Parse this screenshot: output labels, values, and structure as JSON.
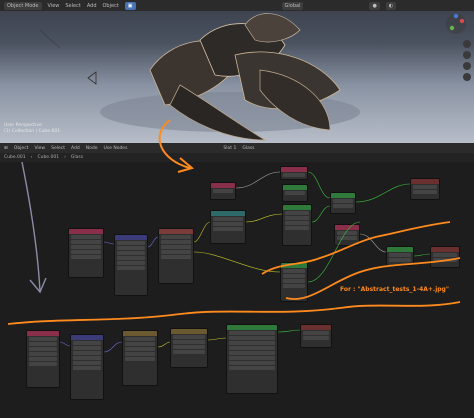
{
  "viewport": {
    "header": {
      "mode": "Object Mode",
      "view": "View",
      "select": "Select",
      "add": "Add",
      "object": "Object",
      "global": "Global"
    },
    "info_line1": "User Perspective",
    "info_line2": "(1) Collection | Cube.001"
  },
  "node_editor": {
    "header": {
      "editor": "Object",
      "view": "View",
      "select": "Select",
      "add": "Add",
      "node": "Node",
      "use_nodes": "Use Nodes",
      "slot": "Slot 1",
      "material": "Glass"
    },
    "breadcrumb": [
      "Cube.001",
      "Cube.001",
      "Glass"
    ]
  },
  "annotation": "For : \"Abstract_tests_1-4A+.jpg\"",
  "colors": {
    "accent": "#ff8a1e",
    "select": "#4772b3"
  }
}
